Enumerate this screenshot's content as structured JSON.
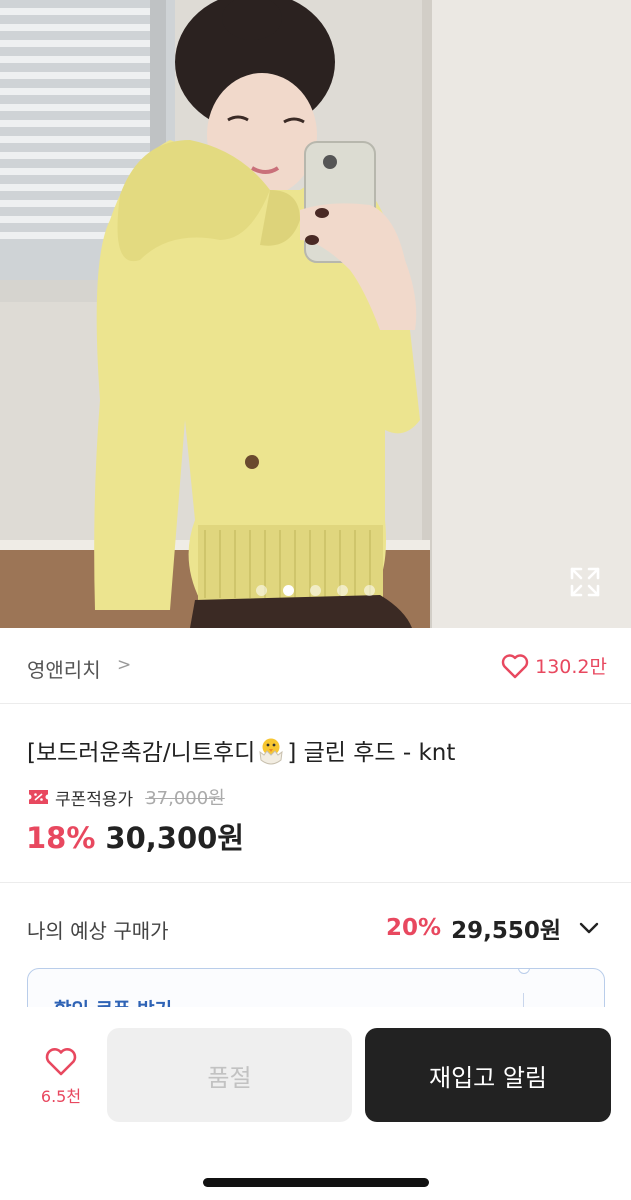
{
  "store": {
    "name": "영앤리치",
    "chevron": ">",
    "like_count": "130.2만"
  },
  "product": {
    "title_prefix": "[보드러운촉감/니트후디",
    "title_suffix": "] 글린 후드 - knt",
    "coupon_label": "쿠폰적용가",
    "original_price": "37,000원",
    "discount": "18%",
    "price": "30,300원"
  },
  "carousel": {
    "total": 5,
    "active_index": 1
  },
  "expected": {
    "label": "나의 예상 구매가",
    "discount": "20%",
    "price": "29,550원"
  },
  "coupon_box": {
    "label": "할인 쿠폰 받기"
  },
  "bottom": {
    "wish_count": "6.5천",
    "soldout_label": "품절",
    "restock_label": "재입고 알림"
  },
  "colors": {
    "accent": "#e8485f",
    "dark_button": "#222222",
    "coupon_blue": "#2f63b5"
  },
  "icons": {
    "expand": "expand-arrows-icon",
    "heart": "heart-outline-icon",
    "coupon": "coupon-ticket-icon",
    "chevron_down": "chevron-down-icon"
  }
}
